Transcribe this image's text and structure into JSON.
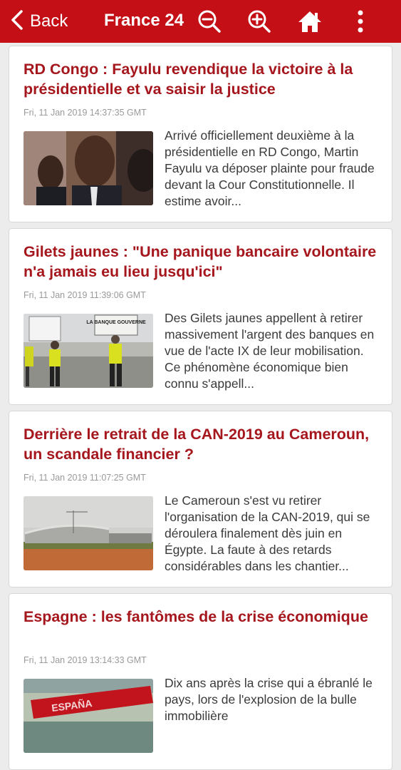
{
  "header": {
    "back_label": "Back",
    "title": "France 24",
    "background_color": "#c30f15",
    "icons": [
      "chevron-left-icon",
      "zoom-out-icon",
      "zoom-in-icon",
      "home-icon",
      "more-vertical-icon"
    ]
  },
  "articles": [
    {
      "title": "RD Congo : Fayulu revendique la victoire à la présidentielle et va saisir la justice",
      "date": "Fri, 11 Jan 2019 14:37:35 GMT",
      "summary": "Arrivé officiellement deuxième à la présidentielle en RD Congo, Martin Fayulu va déposer plainte pour fraude devant la Cour Constitutionnelle. Il estime avoir...",
      "image": "portrait-photo"
    },
    {
      "title": "Gilets jaunes : \"Une panique bancaire volontaire n'a jamais eu lieu jusqu'ici\"",
      "date": "Fri, 11 Jan 2019 11:39:06 GMT",
      "summary": "Des Gilets jaunes appellent à retirer massivement l'argent des banques en vue de l'acte IX de leur mobilisation. Ce phénomène économique bien connu s'appell...",
      "image": "protest-photo",
      "image_text": "LA BANQUE GOUVERNE"
    },
    {
      "title": "Derrière le retrait de la CAN-2019 au Cameroun, un scandale financier ?",
      "date": "Fri, 11 Jan 2019 11:07:25 GMT",
      "summary": "Le Cameroun s'est vu retirer l'organisation de la CAN-2019, qui se déroulera finalement dès juin en Égypte. La faute à des retards considérables dans les chantier...",
      "image": "stadium-photo"
    },
    {
      "title": "Espagne : les fantômes de la crise économique",
      "date": "Fri, 11 Jan 2019 13:14:33 GMT",
      "summary": "Dix ans après la crise qui a ébranlé le pays, lors de l'explosion de la bulle immobilière",
      "image": "espana-sign-photo",
      "image_text": "ESPAÑA"
    }
  ]
}
